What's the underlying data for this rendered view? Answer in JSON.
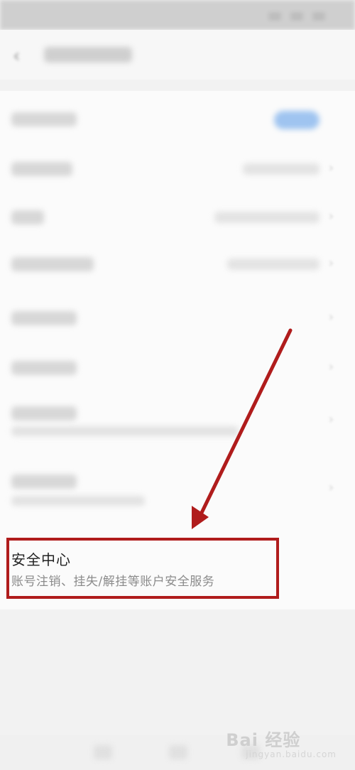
{
  "security_center": {
    "title": "安全中心",
    "subtitle": "账号注销、挂失/解挂等账户安全服务"
  },
  "watermark": {
    "brand": "Bai 经验",
    "url": "jingyan.baidu.com"
  },
  "colors": {
    "highlight": "#b01c1c",
    "toggle": "#9fc4f0"
  },
  "icons": {
    "back": "back-arrow-icon",
    "chevron": "chevron-right-icon"
  }
}
